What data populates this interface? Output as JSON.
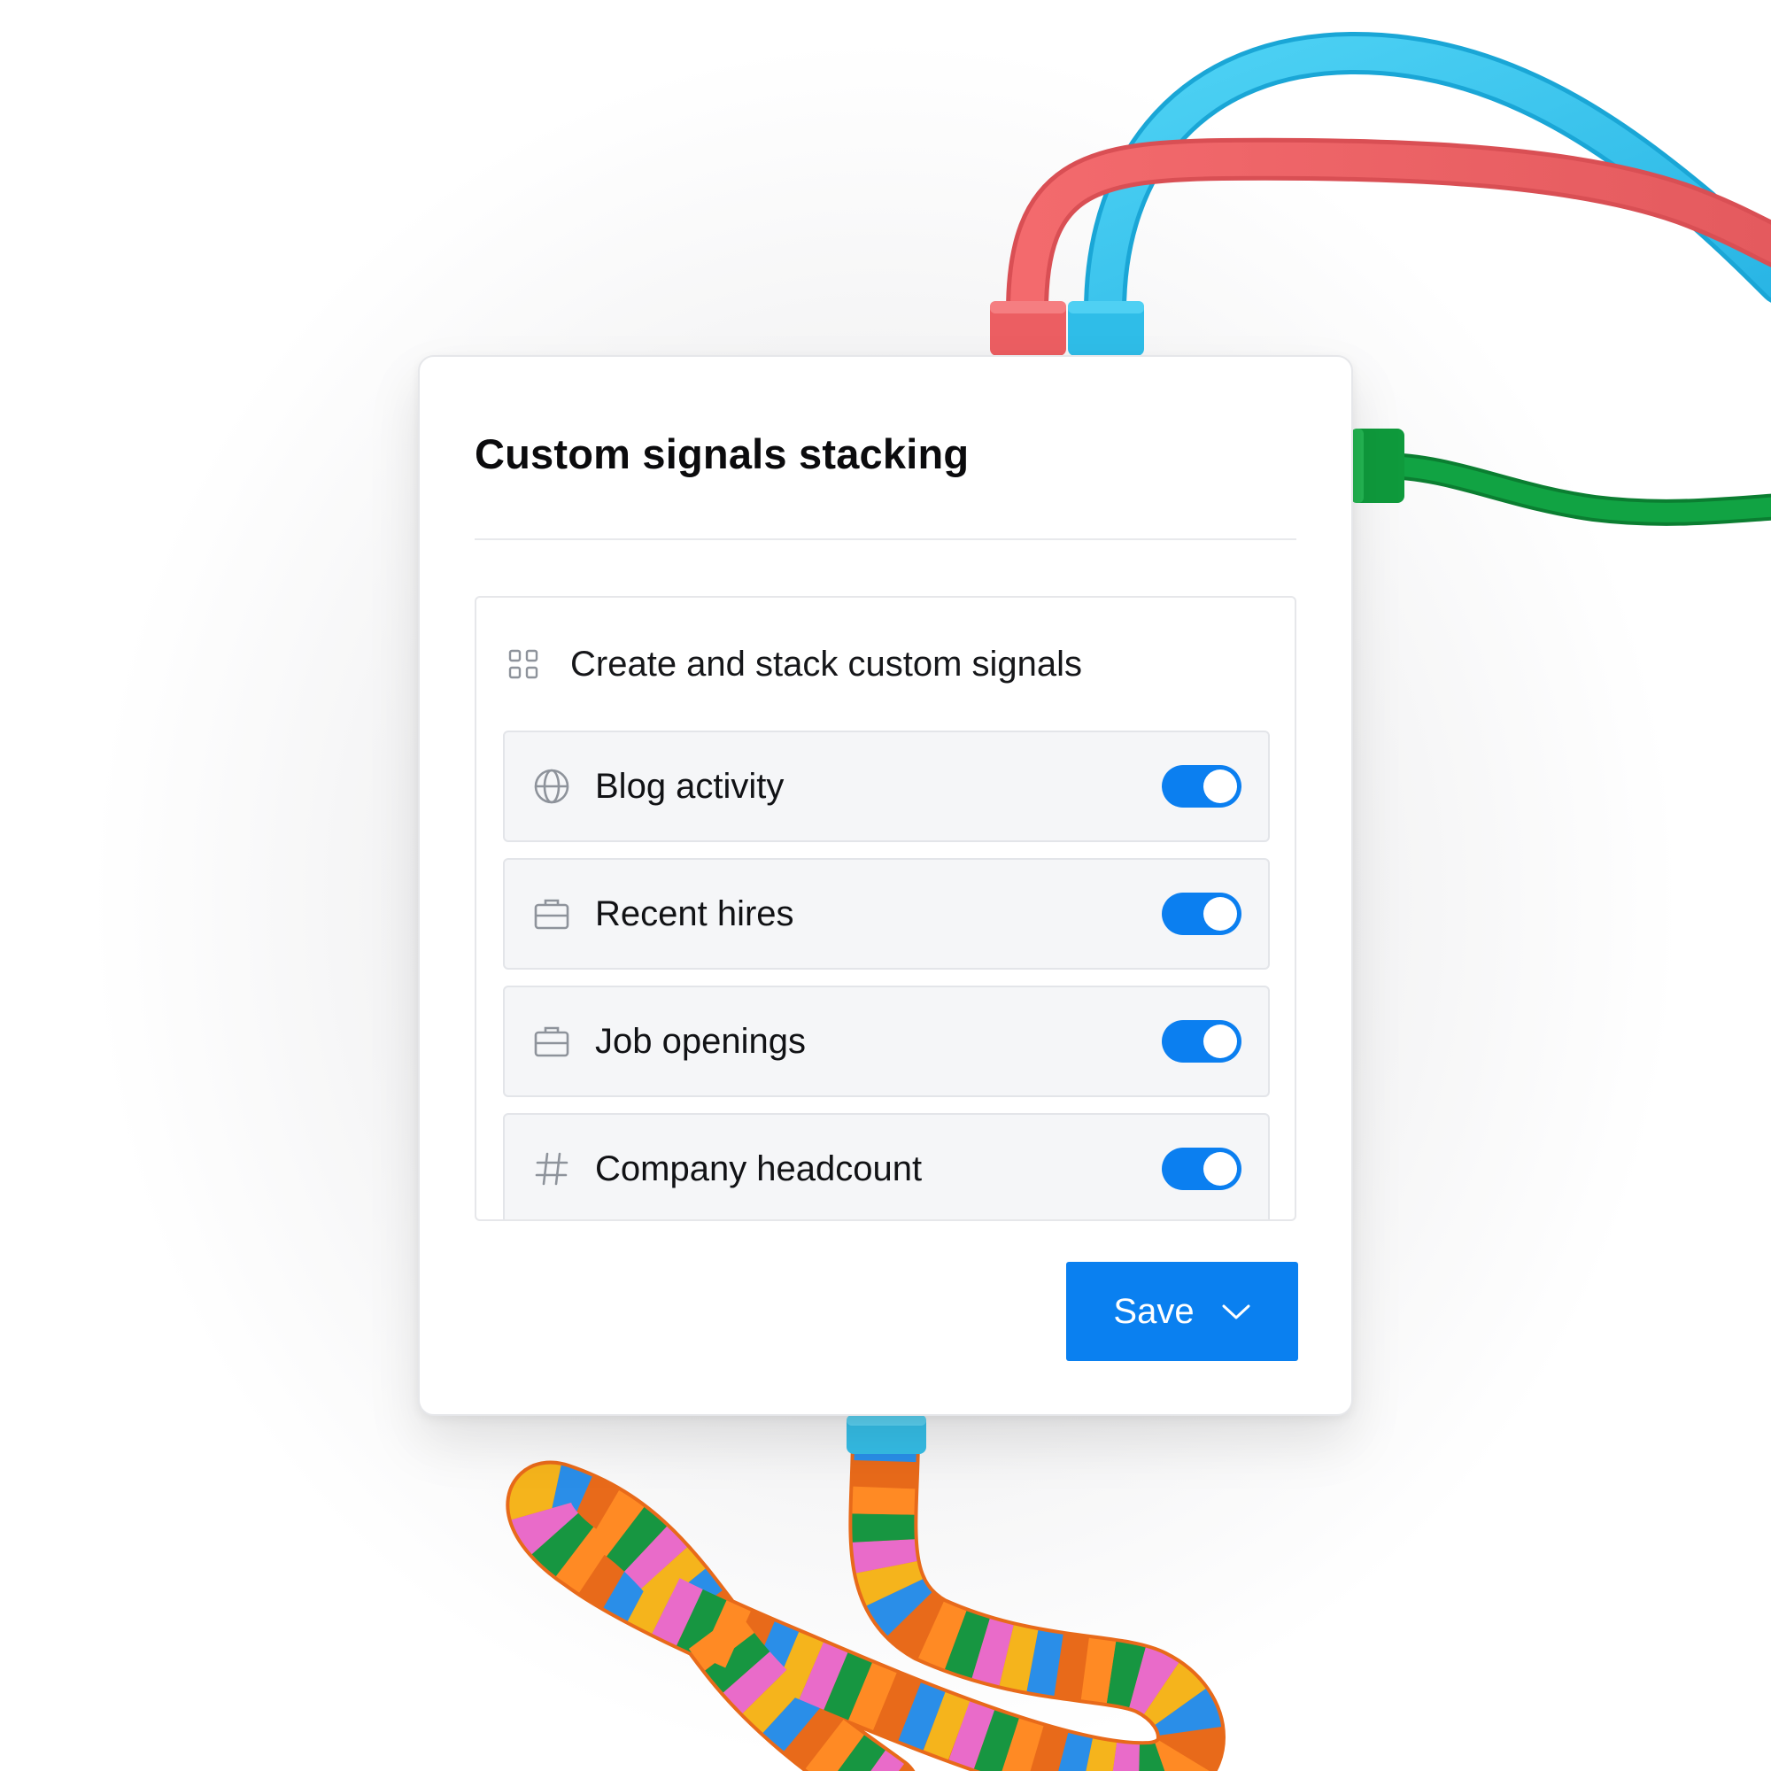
{
  "colors": {
    "accent": "#0a80f0",
    "toggle_on": "#0b7ff0",
    "row_background": "#f5f6f8",
    "icon_gray": "#8e939b",
    "cable_red": "#f0666a",
    "cable_blue": "#3ec8ef",
    "cable_green": "#0f9a3c"
  },
  "card": {
    "title": "Custom signals stacking"
  },
  "panel": {
    "icon": "grid-icon",
    "title": "Create and stack custom signals",
    "rows": [
      {
        "label": "Blog activity",
        "icon": "globe-icon",
        "enabled": true
      },
      {
        "label": "Recent hires",
        "icon": "briefcase-icon",
        "enabled": true
      },
      {
        "label": "Job openings",
        "icon": "briefcase-icon",
        "enabled": true
      },
      {
        "label": "Company headcount",
        "icon": "hash-icon",
        "enabled": true
      }
    ]
  },
  "save": {
    "label": "Save",
    "icon": "chevron-down-icon"
  }
}
